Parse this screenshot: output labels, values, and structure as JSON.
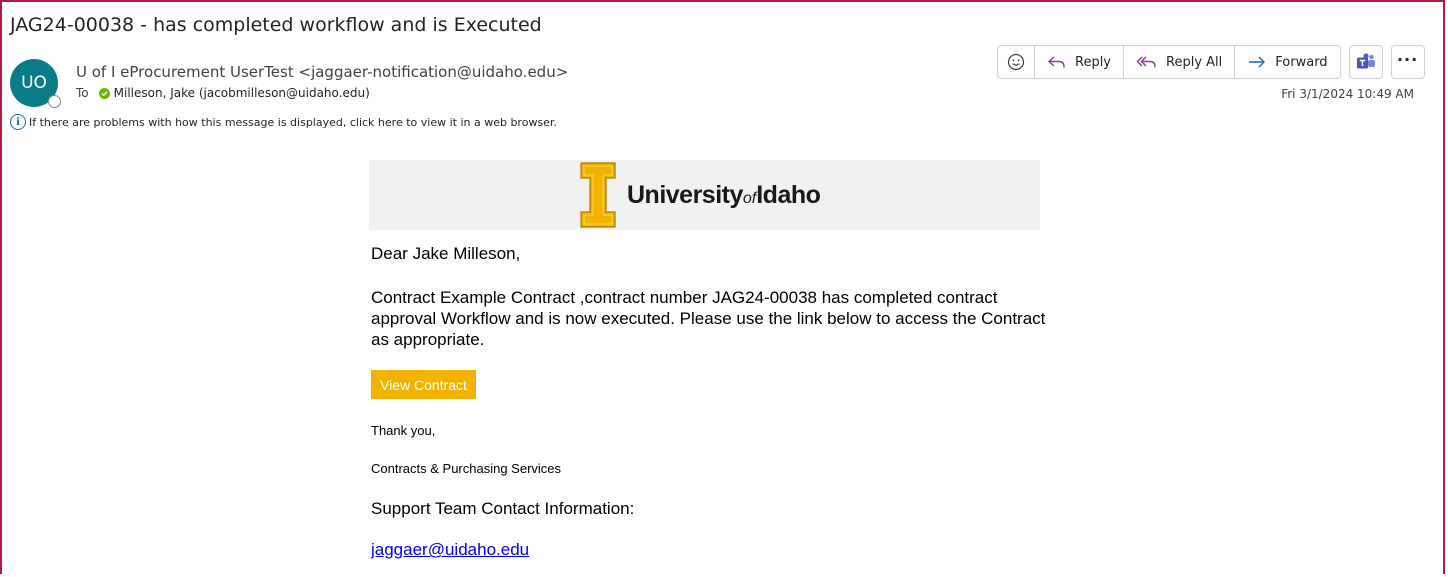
{
  "email": {
    "subject": "JAG24-00038 - has completed workflow and is Executed",
    "sender_initials": "UO",
    "sender": "U of I eProcurement UserTest <jaggaer-notification@uidaho.edu>",
    "to_label": "To",
    "recipient": "Milleson, Jake (jacobmilleson@uidaho.edu)",
    "info_notice": "If there are problems with how this message is displayed, click here to view it in a web browser.",
    "timestamp": "Fri 3/1/2024 10:49 AM"
  },
  "actions": {
    "reply": "Reply",
    "reply_all": "Reply All",
    "forward": "Forward",
    "more": "···"
  },
  "banner": {
    "logo_part1": "University",
    "logo_of": "of",
    "logo_part2": "Idaho"
  },
  "body": {
    "greeting": "Dear Jake Milleson,",
    "message": "Contract Example Contract ,contract number JAG24-00038 has completed contract approval Workflow and is now executed. Please use the link below to access the Contract as appropriate.",
    "button": "View Contract",
    "thanks": "Thank you,",
    "department": "Contracts & Purchasing Services",
    "support_heading": "Support Team Contact Information:",
    "support_email": "jaggaer@uidaho.edu"
  },
  "colors": {
    "avatar": "#0a7c87",
    "accent_gold": "#f1b300",
    "frame_border": "#b01c3e",
    "link": "#0000ee"
  },
  "icons": [
    "emoji-icon",
    "reply-icon",
    "reply-all-icon",
    "forward-icon",
    "teams-icon",
    "more-icon",
    "info-icon",
    "presence-check-icon"
  ]
}
